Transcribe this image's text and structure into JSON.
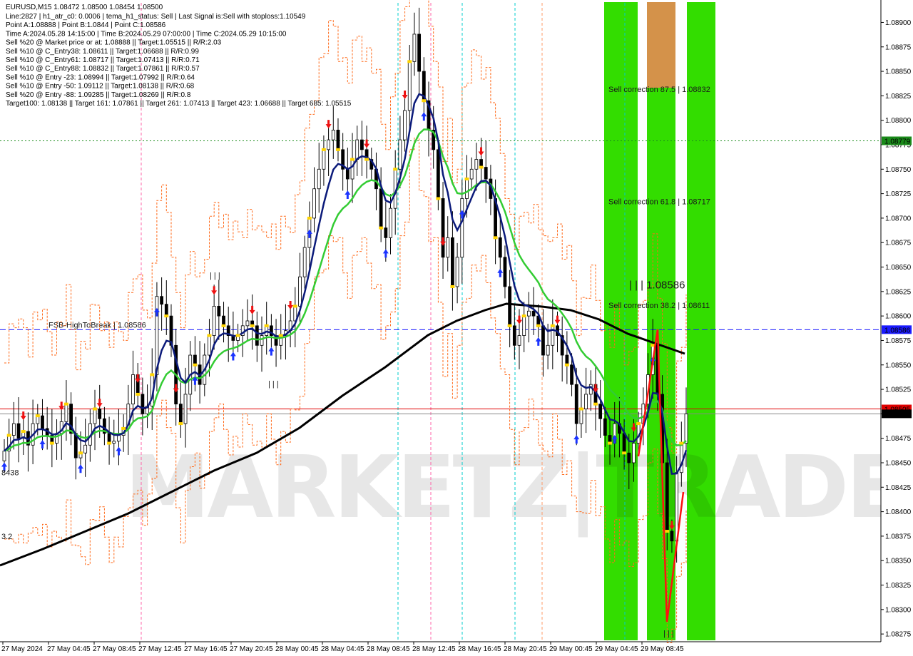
{
  "window": {
    "symbol_line": "EURUSD,M15  1.08472 1.08500 1.08454 1.08500"
  },
  "info_lines": [
    "Line:2827 | h1_atr_c0: 0.0006 | tema_h1_status: Sell | Last Signal is:Sell with stoploss:1.10549",
    "Point A:1.08888 | Point B:1.0844 | Point C:1.08586",
    "Time A:2024.05.28 14:15:00 | Time B:2024.05.29 07:00:00 | Time C:2024.05.29 10:15:00",
    "Sell %20 @ Market price or at: 1.08888 || Target:1.05515 || R/R:2.03",
    "Sell %10 @ C_Entry38: 1.08611 || Target:1.06688 || R/R:0.99",
    "Sell %10 @ C_Entry61: 1.08717 || Target:1.07413 || R/R:0.71",
    "Sell %10 @ C_Entry88: 1.08832 || Target:1.07861 || R/R:0.57",
    "Sell %10 @ Entry -23: 1.08994 || Target:1.07992 || R/R:0.64",
    "Sell %10 @ Entry -50: 1.09112 || Target:1.08138 || R/R:0.68",
    "Sell %20 @ Entry -88: 1.09285 || Target:1.08269 || R/R:0.8",
    "Target100: 1.08138 || Target 161: 1.07861 || Target 261: 1.07413 || Target 423: 1.06688 || Target 685: 1.05515"
  ],
  "watermark": "MARKETZ|TRADE",
  "chart_data": {
    "type": "candlestick",
    "symbol": "EURUSD",
    "timeframe": "M15",
    "ylim": [
      1.0827,
      1.0892
    ],
    "y_ticks": [
      "1.08900",
      "1.08875",
      "1.08850",
      "1.08825",
      "1.08800",
      "1.08775",
      "1.08750",
      "1.08725",
      "1.08700",
      "1.08675",
      "1.08650",
      "1.08625",
      "1.08600",
      "1.08575",
      "1.08550",
      "1.08525",
      "1.08500",
      "1.08475",
      "1.08450",
      "1.08425",
      "1.08400",
      "1.08375",
      "1.08350",
      "1.08325",
      "1.08300",
      "1.08275"
    ],
    "x_ticks": [
      "27 May 2024",
      "27 May 04:45",
      "27 May 08:45",
      "27 May 12:45",
      "27 May 16:45",
      "27 May 20:45",
      "28 May 00:45",
      "28 May 04:45",
      "28 May 08:45",
      "28 May 12:45",
      "28 May 16:45",
      "28 May 20:45",
      "29 May 00:45",
      "29 May 04:45",
      "29 May 08:45"
    ],
    "candles_close": [
      1.08462,
      1.08478,
      1.0849,
      1.08475,
      1.08482,
      1.08468,
      1.0849,
      1.08498,
      1.08485,
      1.08478,
      1.0847,
      1.0848,
      1.08492,
      1.0851,
      1.0848,
      1.08455,
      1.0846,
      1.08468,
      1.0849,
      1.08505,
      1.08495,
      1.0848,
      1.0847,
      1.08472,
      1.08478,
      1.08485,
      1.0851,
      1.0854,
      1.0852,
      1.085,
      1.08508,
      1.0854,
      1.0862,
      1.08612,
      1.086,
      1.0857,
      1.0851,
      1.0849,
      1.0852,
      1.0856,
      1.0855,
      1.0853,
      1.0856,
      1.0858,
      1.0861,
      1.086,
      1.0859,
      1.0858,
      1.08575,
      1.0858,
      1.0859,
      1.08595,
      1.0859,
      1.0857,
      1.0858,
      1.0859,
      1.0858,
      1.0857,
      1.0858,
      1.08585,
      1.08595,
      1.0861,
      1.0864,
      1.0867,
      1.087,
      1.0873,
      1.0875,
      1.0877,
      1.0878,
      1.0879,
      1.0877,
      1.0875,
      1.0874,
      1.0876,
      1.0878,
      1.0877,
      1.0876,
      1.0875,
      1.0873,
      1.0869,
      1.0868,
      1.0871,
      1.0875,
      1.0878,
      1.0881,
      1.0886,
      1.08888,
      1.0885,
      1.0882,
      1.0879,
      1.0877,
      1.0872,
      1.0866,
      1.0868,
      1.0863,
      1.0866,
      1.0872,
      1.0874,
      1.0875,
      1.0876,
      1.08752,
      1.0874,
      1.0872,
      1.0868,
      1.0866,
      1.0863,
      1.0859,
      1.0857,
      1.0858,
      1.086,
      1.08605,
      1.086,
      1.0859,
      1.0856,
      1.0857,
      1.0859,
      1.0858,
      1.0856,
      1.0855,
      1.0853,
      1.0849,
      1.08505,
      1.0852,
      1.0853,
      1.0851,
      1.08495,
      1.08478,
      1.0847,
      1.0849,
      1.0848,
      1.0846,
      1.0845,
      1.0847,
      1.0849,
      1.0851,
      1.0854,
      1.0857,
      1.0852,
      1.0845,
      1.0838,
      1.0837,
      1.0844,
      1.0847,
      1.085
    ],
    "indicators": [
      {
        "name": "EMA fast (navy)",
        "color": "#0b1a7a"
      },
      {
        "name": "EMA medium (green)",
        "color": "#33cc33"
      },
      {
        "name": "EMA slow (black)",
        "color": "#000000"
      },
      {
        "name": "Channel (orange dashed)",
        "color": "#ff6a1a"
      }
    ],
    "levels": [
      {
        "label": "FSB-HighToBreak | 1.08586",
        "value": 1.08586,
        "color": "#1a1aff",
        "style": "dashed",
        "badge": "1.08586"
      },
      {
        "value": 1.08779,
        "color": "#1a8a1a",
        "style": "dotted",
        "badge": "1.08779"
      },
      {
        "value": 1.08505,
        "color": "#e00000",
        "style": "solid",
        "badge": "1.08505"
      },
      {
        "value": 1.085,
        "color": "#888888",
        "style": "solid",
        "badge": "1.08500"
      }
    ],
    "zone_annotations": [
      {
        "label": "Sell correction 87.5 | 1.08832",
        "value": 1.08832
      },
      {
        "label": "Sell correction 61.8 | 1.08717",
        "value": 1.08717
      },
      {
        "label": "Sell correction 38.2 | 1.08611",
        "value": 1.08611
      }
    ],
    "big_label": "| | | 1.08586",
    "left_labels": [
      "8438",
      "3.2"
    ],
    "mid_marks": [
      "| | |",
      "| | |"
    ],
    "bottom_mark": "| | |",
    "zone_colors": {
      "green": "#33dd00",
      "orange": "#d4924a"
    }
  }
}
